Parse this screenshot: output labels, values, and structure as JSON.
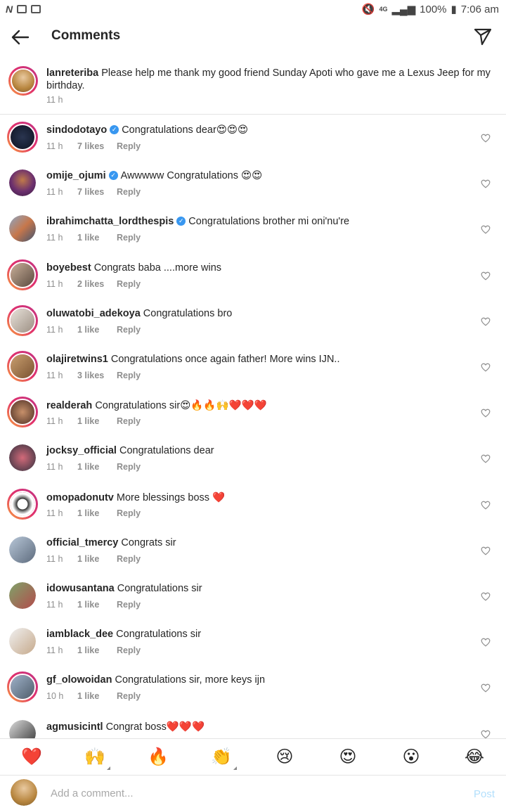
{
  "status_bar": {
    "battery": "100%",
    "time": "7:06 am",
    "network": "4G"
  },
  "header": {
    "title": "Comments"
  },
  "caption": {
    "username": "lanreteriba",
    "text": "Please help me thank my good friend Sunday Apoti who gave me a Lexus Jeep for my birthday.",
    "time": "11 h"
  },
  "comments": [
    {
      "username": "sindodotayo",
      "verified": true,
      "text": "Congratulations dear😍😍😍",
      "time": "11 h",
      "likes": "7 likes",
      "reply": "Reply"
    },
    {
      "username": "omije_ojumi",
      "verified": true,
      "text": "Awwwww Congratulations 😍😍",
      "time": "11 h",
      "likes": "7 likes",
      "reply": "Reply"
    },
    {
      "username": "ibrahimchatta_lordthespis",
      "verified": true,
      "text": "Congratulations brother mi oni'nu're",
      "time": "11 h",
      "likes": "1 like",
      "reply": "Reply"
    },
    {
      "username": "boyebest",
      "verified": false,
      "text": "Congrats baba ....more wins",
      "time": "11 h",
      "likes": "2 likes",
      "reply": "Reply"
    },
    {
      "username": "oluwatobi_adekoya",
      "verified": false,
      "text": "Congratulations bro",
      "time": "11 h",
      "likes": "1 like",
      "reply": "Reply"
    },
    {
      "username": "olajiretwins1",
      "verified": false,
      "text": "Congratulations once again father! More wins IJN..",
      "time": "11 h",
      "likes": "3 likes",
      "reply": "Reply"
    },
    {
      "username": "realderah",
      "verified": false,
      "text": "Congratulations sir😍🔥🔥🙌❤️❤️❤️",
      "time": "11 h",
      "likes": "1 like",
      "reply": "Reply"
    },
    {
      "username": "jocksy_official",
      "verified": false,
      "text": "Congratulations dear",
      "time": "11 h",
      "likes": "1 like",
      "reply": "Reply"
    },
    {
      "username": "omopadonutv",
      "verified": false,
      "text": "More blessings boss ❤️",
      "time": "11 h",
      "likes": "1 like",
      "reply": "Reply"
    },
    {
      "username": "official_tmercy",
      "verified": false,
      "text": "Congrats sir",
      "time": "11 h",
      "likes": "1 like",
      "reply": "Reply"
    },
    {
      "username": "idowusantana",
      "verified": false,
      "text": "Congratulations sir",
      "time": "11 h",
      "likes": "1 like",
      "reply": "Reply"
    },
    {
      "username": "iamblack_dee",
      "verified": false,
      "text": "Congratulations sir",
      "time": "11 h",
      "likes": "1 like",
      "reply": "Reply"
    },
    {
      "username": "gf_olowoidan",
      "verified": false,
      "text": "Congratulations sir, more keys ijn",
      "time": "10 h",
      "likes": "1 like",
      "reply": "Reply"
    },
    {
      "username": "agmusicintl",
      "verified": false,
      "text": "Congrat boss❤️❤️❤️",
      "time": "",
      "likes": "",
      "reply": ""
    }
  ],
  "emoji_bar": [
    "❤️",
    "🙌",
    "🔥",
    "👏",
    "😢",
    "😍",
    "😮",
    "😂"
  ],
  "input": {
    "placeholder": "Add a comment...",
    "post_label": "Post"
  },
  "colors": {
    "accent": "#3897f0",
    "post_disabled": "#b2dffc",
    "muted": "#8e8e8e"
  }
}
